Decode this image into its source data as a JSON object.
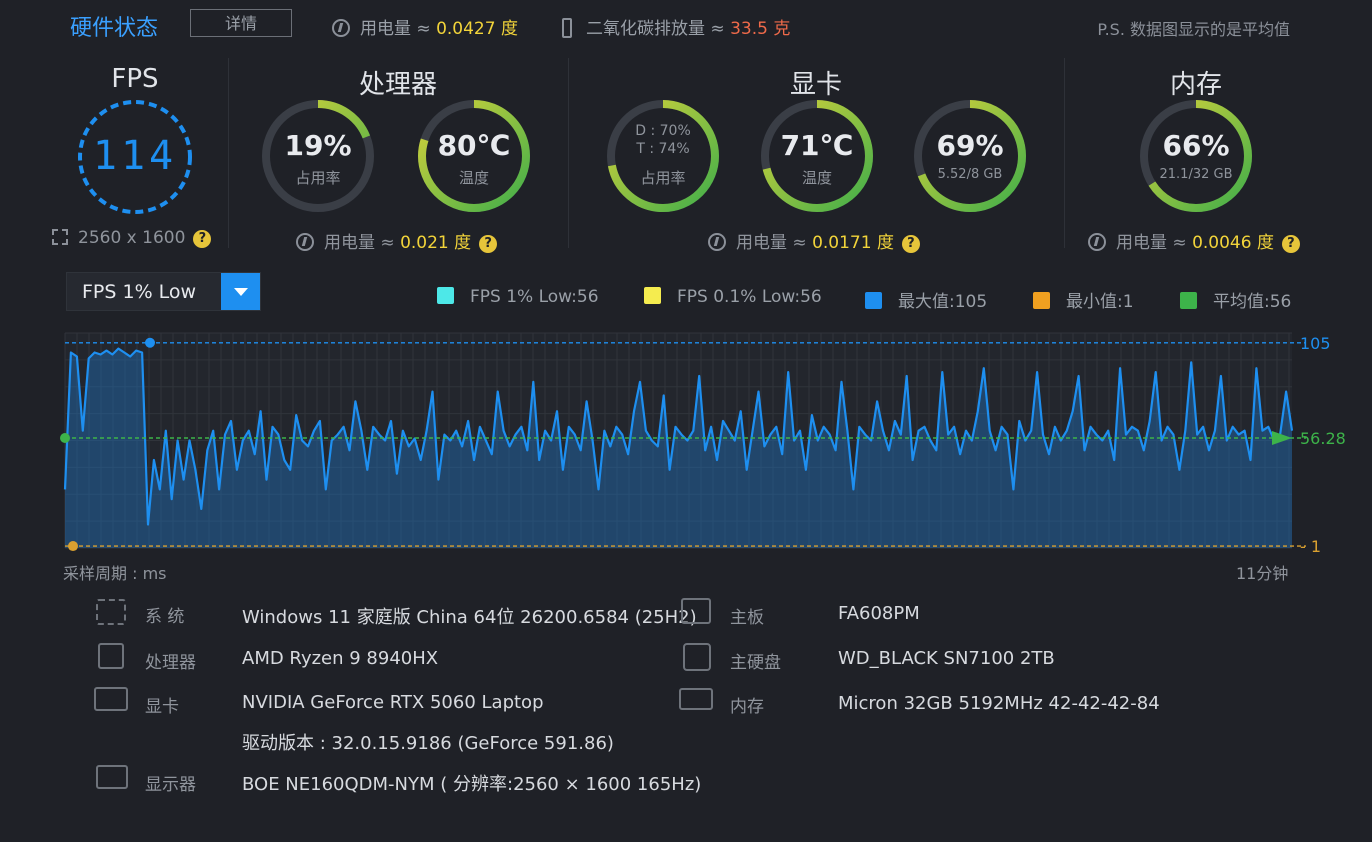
{
  "header": {
    "title": "硬件状态",
    "detail_button": "详情",
    "power_label": "用电量 ≈",
    "power_value": "0.0427 度",
    "co2_label": "二氧化碳排放量 ≈",
    "co2_value": "33.5 克",
    "ps_note": "P.S. 数据图显示的是平均值"
  },
  "fps": {
    "title": "FPS",
    "value": "114",
    "resolution": "2560 x 1600"
  },
  "cpu": {
    "title": "处理器",
    "usage_value": "19%",
    "usage_label": "占用率",
    "usage_fraction": 0.19,
    "temp_value": "80℃",
    "temp_label": "温度",
    "temp_fraction": 0.8,
    "power_label": "用电量 ≈",
    "power_value": "0.021 度"
  },
  "gpu": {
    "title": "显卡",
    "d_usage": "D : 70%",
    "t_usage": "T : 74%",
    "usage_label": "占用率",
    "usage_fraction": 0.72,
    "temp_value": "71℃",
    "temp_label": "温度",
    "temp_fraction": 0.71,
    "vram_value": "69%",
    "vram_label": "5.52/8 GB",
    "vram_fraction": 0.69,
    "power_label": "用电量 ≈",
    "power_value": "0.0171 度"
  },
  "memory": {
    "title": "内存",
    "usage_value": "66%",
    "usage_label": "21.1/32 GB",
    "usage_fraction": 0.66,
    "power_label": "用电量 ≈",
    "power_value": "0.0046 度"
  },
  "help_glyph": "?",
  "dropdown": {
    "selected": "FPS 1% Low"
  },
  "legend": [
    {
      "label": "FPS 1% Low:56",
      "color": "#4de8e8"
    },
    {
      "label": "FPS 0.1% Low:56",
      "color": "#f5ec4f"
    },
    {
      "label": "最大值:105",
      "color": "#1e8ff0"
    },
    {
      "label": "最小值:1",
      "color": "#f0a020"
    },
    {
      "label": "平均值:56",
      "color": "#3db34a"
    }
  ],
  "chart_data": {
    "type": "area",
    "ylim": [
      0,
      110
    ],
    "max_value": 105,
    "min_value": 1,
    "avg_value": 56.28,
    "max_label": "105",
    "avg_label": "56.28",
    "min_label": "1",
    "xlabel": "采样周期 : ms",
    "x_end_label": "11分钟",
    "series_color": "#1e8ff0",
    "avg_color": "#3db34a",
    "min_color": "#d9a030",
    "values": [
      30,
      100,
      98,
      60,
      97,
      100,
      99,
      101,
      99,
      102,
      100,
      98,
      101,
      100,
      12,
      45,
      30,
      60,
      25,
      55,
      35,
      55,
      40,
      20,
      50,
      60,
      30,
      58,
      65,
      40,
      55,
      60,
      48,
      70,
      35,
      62,
      58,
      45,
      40,
      68,
      55,
      52,
      60,
      65,
      30,
      55,
      58,
      62,
      50,
      75,
      60,
      40,
      62,
      58,
      55,
      65,
      38,
      60,
      52,
      56,
      45,
      60,
      80,
      35,
      58,
      55,
      60,
      52,
      65,
      45,
      62,
      55,
      48,
      80,
      60,
      52,
      58,
      62,
      50,
      85,
      45,
      60,
      55,
      70,
      40,
      62,
      58,
      50,
      75,
      55,
      30,
      60,
      52,
      62,
      58,
      48,
      70,
      85,
      60,
      55,
      52,
      78,
      40,
      62,
      58,
      55,
      60,
      88,
      50,
      62,
      45,
      65,
      60,
      55,
      70,
      40,
      60,
      80,
      52,
      58,
      62,
      48,
      90,
      55,
      60,
      40,
      68,
      55,
      62,
      58,
      50,
      85,
      60,
      30,
      62,
      58,
      55,
      75,
      60,
      50,
      65,
      58,
      88,
      45,
      60,
      62,
      55,
      50,
      90,
      58,
      62,
      48,
      60,
      55,
      70,
      92,
      60,
      50,
      62,
      58,
      30,
      65,
      55,
      60,
      90,
      58,
      48,
      62,
      55,
      60,
      70,
      88,
      50,
      62,
      58,
      55,
      60,
      45,
      92,
      58,
      62,
      60,
      50,
      65,
      90,
      55,
      62,
      58,
      40,
      60,
      95,
      58,
      62,
      50,
      60,
      88,
      55,
      62,
      58,
      60,
      45,
      92,
      60,
      62,
      55,
      58,
      80,
      60
    ]
  },
  "system_info": {
    "left": [
      {
        "label": "系 统",
        "value": "Windows 11 家庭版 China 64位 26200.6584 (25H2)"
      },
      {
        "label": "处理器",
        "value": "AMD Ryzen 9 8940HX"
      },
      {
        "label": "显卡",
        "value": "NVIDIA GeForce RTX 5060 Laptop"
      },
      {
        "label": "",
        "value": "驱动版本 : 32.0.15.9186 (GeForce 591.86)"
      },
      {
        "label": "显示器",
        "value": "BOE NE160QDM-NYM ( 分辨率:2560 × 1600 165Hz)"
      }
    ],
    "right": [
      {
        "label": "主板",
        "value": "FA608PM"
      },
      {
        "label": "主硬盘",
        "value": "WD_BLACK SN7100 2TB"
      },
      {
        "label": "内存",
        "value": "Micron 32GB 5192MHz 42-42-42-84"
      }
    ]
  }
}
